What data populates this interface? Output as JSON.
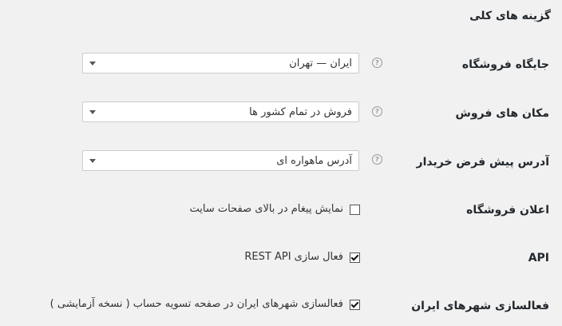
{
  "section": {
    "title": "گزینه های کلی"
  },
  "rows": [
    {
      "label": "جایگاه فروشگاه",
      "value": "ایران — تهران"
    },
    {
      "label": "مکان های فروش",
      "value": "فروش در تمام کشور ها"
    },
    {
      "label": "آدرس پیش فرض خریدار",
      "value": "آدرس ماهواره ای"
    },
    {
      "label": "اعلان فروشگاه",
      "checkbox_label": "نمایش پیغام در بالای صفحات سایت",
      "checked": false
    },
    {
      "label": "API",
      "checkbox_label": "فعال سازی REST API",
      "checked": true
    },
    {
      "label": "فعالسازی شهرهای ایران",
      "checkbox_label": "فعالسازی شهرهای ایران در صفحه تسویه حساب ( نسخه آزمایشی )",
      "checked": true
    }
  ],
  "help_icon": "question-circle-icon"
}
